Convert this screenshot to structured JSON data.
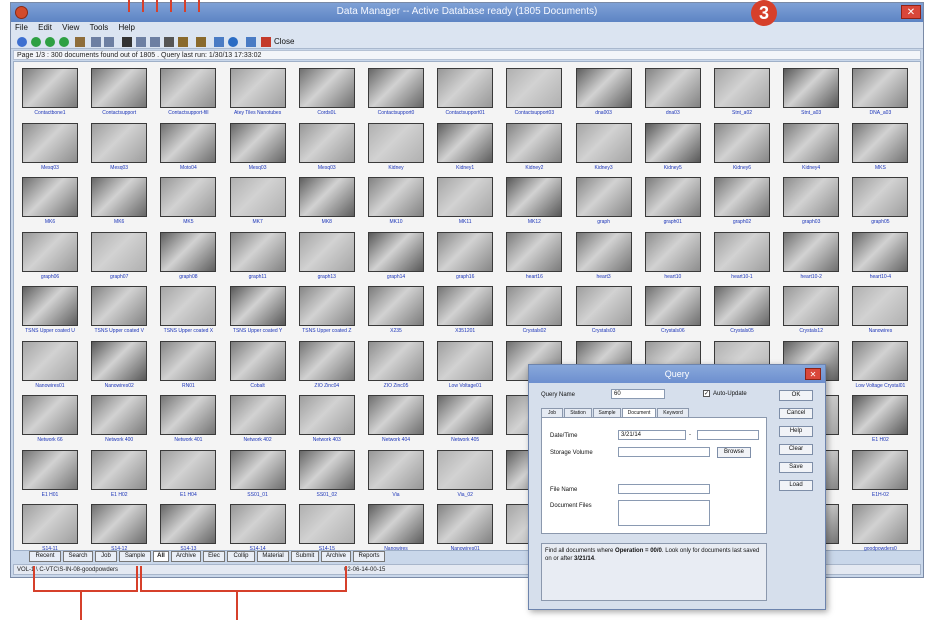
{
  "window": {
    "title": "Data Manager -- Active Database ready (1805 Documents)",
    "close_glyph": "✕"
  },
  "menu": [
    "File",
    "Edit",
    "View",
    "Tools",
    "Help"
  ],
  "toolbar": {
    "close_label": "Close"
  },
  "status_line": "Page 1/3 : 300 documents found out of 1805 . Query last run: 1/30/13 17:33:02",
  "callout_number": "3",
  "grid": {
    "thumb_colors": [
      "#7b7b7b",
      "#8d8d8d",
      "#6f6f6f",
      "#979797",
      "#5e5e5e",
      "#a5a5a5",
      "#868686",
      "#747474",
      "#9e9e9e",
      "#666666",
      "#b0b0b0",
      "#828282",
      "#585858"
    ],
    "thumbnails": [
      "Contactbone1",
      "Contactsupport",
      "Contactsupport-fill",
      "Atey Tiles Nanotubes",
      "Cords0L",
      "Contactsupport0",
      "Contactsupport01",
      "Contactsupport03",
      "dna003",
      "dna03",
      "Stnt_a02",
      "Stnt_a03",
      "DNA_a03",
      "Mesq03",
      "Mesq03",
      "Moto04",
      "Mesq03",
      "Mesq03",
      "Kidney",
      "Kidney1",
      "Kidney2",
      "Kidney3",
      "Kidney5",
      "Kidney6",
      "Kidney4",
      "MKS",
      "MK6",
      "MK6",
      "MK5",
      "MK7",
      "MK8",
      "MK10",
      "MK11",
      "MK12",
      "graph",
      "graph01",
      "graph02",
      "graph03",
      "graph05",
      "graph06",
      "graph07",
      "graph08",
      "graph11",
      "graph13",
      "graph14",
      "graph16",
      "heart16",
      "heart3",
      "heart10",
      "heart10-1",
      "heart10-2",
      "heart10-4",
      "TSNS Upper coated U",
      "TSNS Upper coated V",
      "TSNS Upper coated X",
      "TSNS Upper coated Y",
      "TSNS Upper coated Z",
      "X235",
      "X351201",
      "Crystals02",
      "Crystals03",
      "Crystals06",
      "Crystals05",
      "Crystals12",
      "Nanowires",
      "Nanowires01",
      "Nanowires02",
      "RN01",
      "Cobalt",
      "ZIO Zinc04",
      "ZIO Zinc05",
      "Low Voltage01",
      "Low",
      "",
      "",
      "",
      "",
      "Low Voltage Crystal01",
      "Network 66",
      "Network 400",
      "Network 401",
      "Network 402",
      "Network 403",
      "Network 404",
      "Network 405",
      "Net",
      "",
      "",
      "",
      "",
      "E1 H02",
      "E1 H01",
      "E1 H02",
      "E1 H04",
      "SS01_01",
      "SS01_02",
      "Via",
      "Via_02",
      "",
      "",
      "",
      "",
      "",
      "E1H-02",
      "S14-11",
      "S14-12",
      "S14-13",
      "S14-14",
      "S14-15",
      "Nanowires",
      "Nanowires01",
      "",
      "",
      "",
      "",
      "",
      "goodpowders0"
    ]
  },
  "bottom_tabs": [
    "Recent",
    "Search",
    "Job",
    "Sample",
    "All",
    "Archive",
    "Elec",
    "Collip",
    "Material",
    "Submit",
    "Archive",
    "Reports"
  ],
  "active_tab": "All",
  "bottom_status": {
    "left": "VOL-1 \\ C-VTC\\S-IN-08-goodpowders",
    "right": "02-06-14-00-15"
  },
  "query": {
    "title": "Query",
    "close_glyph": "✕",
    "name_label": "Query Name",
    "name_value": "60",
    "auto_update_label": "Auto-Update",
    "auto_update_checked": true,
    "check_mark": "✓",
    "tabs": [
      "Job",
      "Station",
      "Sample",
      "Document",
      "Keyword"
    ],
    "active_tab": "Document",
    "date_label": "Date/Time",
    "date_from": "3/21/14",
    "date_sep": "-",
    "date_to": "",
    "storage_label": "Storage Volume",
    "storage_value": "",
    "browse_label": "Browse",
    "file_name_label": "File Name",
    "file_name_value": "",
    "doc_files_label": "Document Files",
    "doc_files_value": "",
    "buttons": [
      "OK",
      "Cancel",
      "Help",
      "Clear",
      "Save",
      "Load"
    ],
    "description_pre": "Find all documents where ",
    "description_bold1": "Operation = 00/0",
    "description_mid": ". Look only for documents last saved on or after ",
    "description_bold2": "3/21/14",
    "description_post": "."
  }
}
